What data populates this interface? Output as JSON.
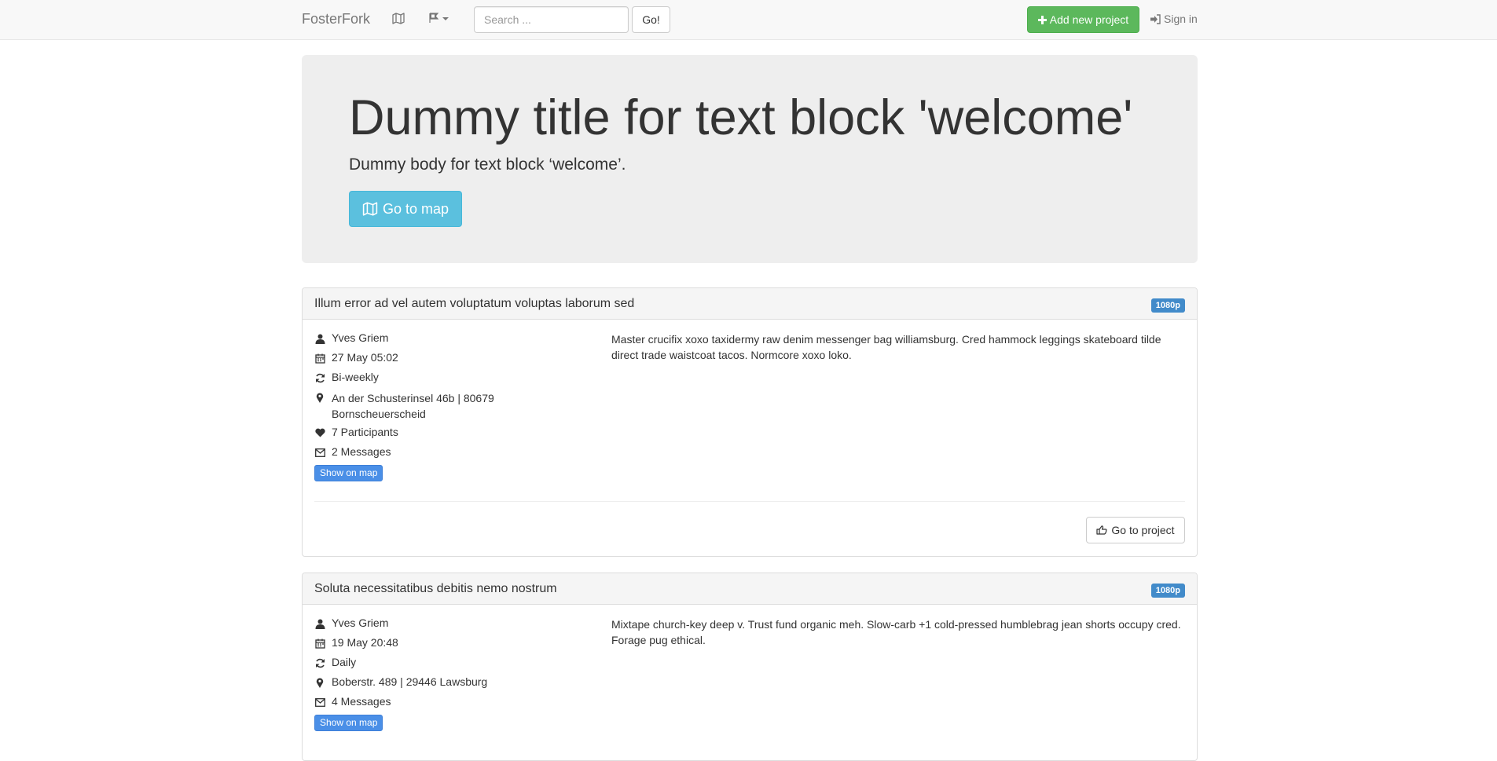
{
  "navbar": {
    "brand": "FosterFork",
    "map_icon": "map-icon",
    "lang_icon": "language-icon",
    "search": {
      "placeholder": "Search ...",
      "value": ""
    },
    "go_label": "Go!",
    "add_project_label": "Add new project",
    "add_icon": "plus-icon",
    "signin_label": "Sign in",
    "signin_icon": "sign-in-icon"
  },
  "jumbotron": {
    "title": "Dummy title for text block 'welcome'",
    "body": "Dummy body for text block ‘welcome’.",
    "map_button_label": "Go to map"
  },
  "projects": [
    {
      "title": "Illum error ad vel autem voluptatum voluptas laborum sed",
      "badge": "1080p",
      "author": "Yves Griem",
      "date": "27 May 05:02",
      "frequency": "Bi-weekly",
      "address": "An der Schusterinsel 46b | 80679 Bornscheuerscheid",
      "participants": "7 Participants",
      "messages": "2 Messages",
      "map_link": "Show on map",
      "description": "Master crucifix xoxo taxidermy raw denim messenger bag williamsburg. Cred hammock leggings skateboard tilde direct trade waistcoat tacos. Normcore xoxo loko.",
      "go_label": "Go to project"
    },
    {
      "title": "Soluta necessitatibus debitis nemo nostrum",
      "badge": "1080p",
      "author": "Yves Griem",
      "date": "19 May 20:48",
      "frequency": "Daily",
      "address": "Boberstr. 489 | 29446 Lawsburg",
      "messages": "4 Messages",
      "map_link": "Show on map",
      "description": "Mixtape church-key deep v. Trust fund organic meh. Slow-carb +1 cold-pressed humblebrag jean shorts occupy cred. Forage pug ethical."
    }
  ],
  "colors": {
    "success": "#5cb85c",
    "info": "#5bc0de",
    "primary": "#428bca"
  }
}
